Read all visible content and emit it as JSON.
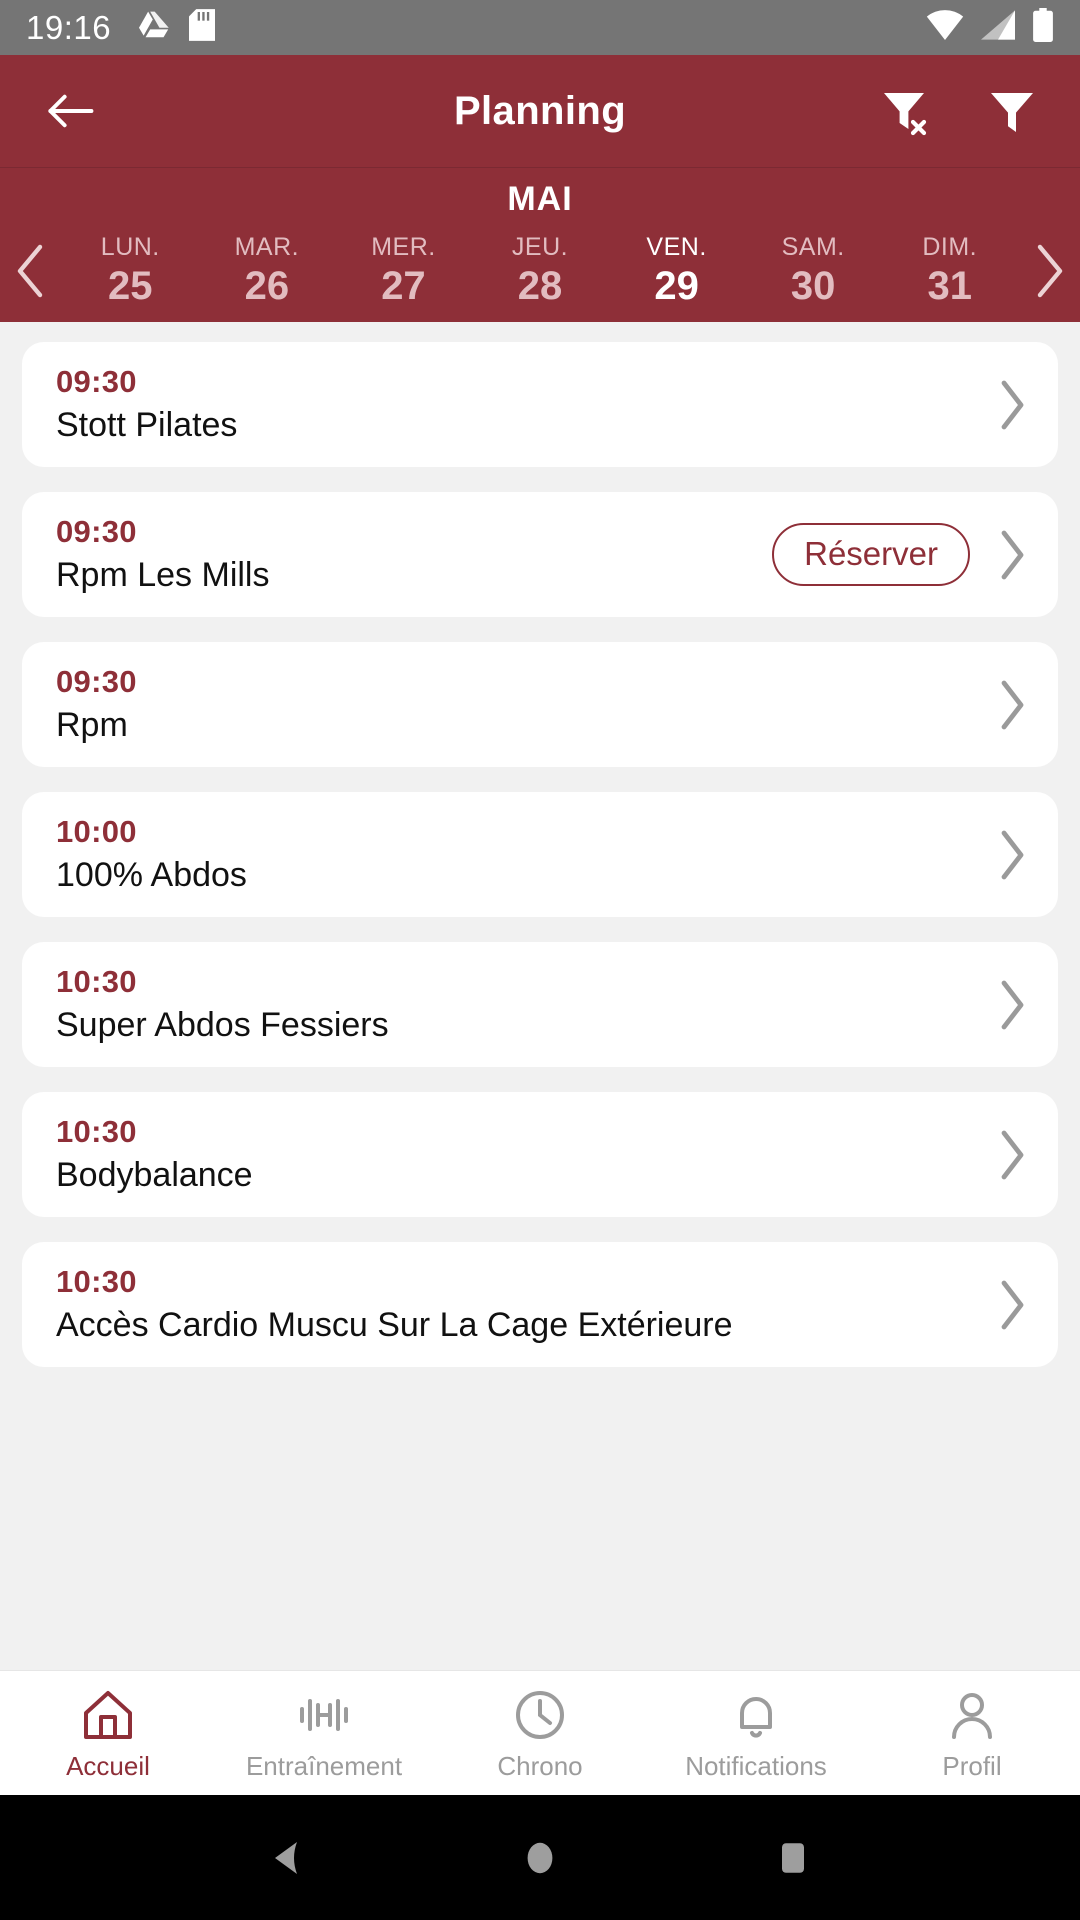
{
  "status_bar": {
    "time": "19:16",
    "left_icons": [
      "google-drive-icon",
      "sd-card-icon"
    ],
    "right_icons": [
      "wifi-icon",
      "cellular-signal-icon",
      "battery-icon"
    ],
    "background_color": "#757575"
  },
  "app_bar": {
    "title": "Planning",
    "back_icon": "arrow-left-icon",
    "actions": [
      "filter-clear-icon",
      "filter-icon"
    ],
    "background_color": "#8E2F38",
    "text_color": "#FFFFFF"
  },
  "calendar": {
    "month": "MAI",
    "prev_icon": "chevron-left-icon",
    "next_icon": "chevron-right-icon",
    "days": [
      {
        "dow": "LUN.",
        "num": "25",
        "selected": false
      },
      {
        "dow": "MAR.",
        "num": "26",
        "selected": false
      },
      {
        "dow": "MER.",
        "num": "27",
        "selected": false
      },
      {
        "dow": "JEU.",
        "num": "28",
        "selected": false
      },
      {
        "dow": "VEN.",
        "num": "29",
        "selected": true
      },
      {
        "dow": "SAM.",
        "num": "30",
        "selected": false
      },
      {
        "dow": "DIM.",
        "num": "31",
        "selected": false
      }
    ]
  },
  "sessions": [
    {
      "time": "09:30",
      "title": "Stott Pilates",
      "reserve_label": null
    },
    {
      "time": "09:30",
      "title": "Rpm Les Mills",
      "reserve_label": "Réserver"
    },
    {
      "time": "09:30",
      "title": "Rpm",
      "reserve_label": null
    },
    {
      "time": "10:00",
      "title": "100% Abdos",
      "reserve_label": null
    },
    {
      "time": "10:30",
      "title": "Super Abdos Fessiers",
      "reserve_label": null
    },
    {
      "time": "10:30",
      "title": "Bodybalance",
      "reserve_label": null
    },
    {
      "time": "10:30",
      "title": "Accès  Cardio Muscu Sur La Cage Extérieure",
      "reserve_label": null
    }
  ],
  "bottom_nav": {
    "items": [
      {
        "label": "Accueil",
        "icon": "home-icon",
        "active": true
      },
      {
        "label": "Entraînement",
        "icon": "dumbbell-icon",
        "active": false
      },
      {
        "label": "Chrono",
        "icon": "clock-icon",
        "active": false
      },
      {
        "label": "Notifications",
        "icon": "bell-icon",
        "active": false
      },
      {
        "label": "Profil",
        "icon": "person-icon",
        "active": false
      }
    ],
    "accent_color": "#8E2F38",
    "inactive_color": "#9C9C9C"
  },
  "android_nav": {
    "back_icon": "triangle-back-icon",
    "home_icon": "circle-home-icon",
    "recents_icon": "square-recents-icon"
  },
  "theme": {
    "primary": "#8E2F38",
    "page_background": "#F1F1F1",
    "card_background": "#FFFFFF",
    "title_text": "#111111",
    "chevron": "#9A9A9A"
  }
}
